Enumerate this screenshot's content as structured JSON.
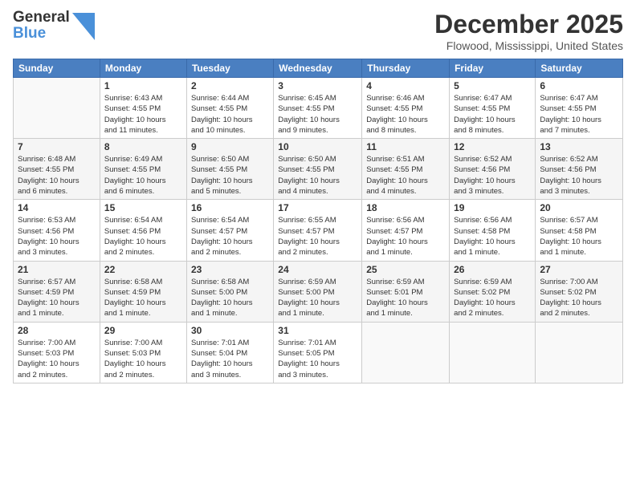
{
  "logo": {
    "line1": "General",
    "line2": "Blue"
  },
  "header": {
    "month": "December 2025",
    "location": "Flowood, Mississippi, United States"
  },
  "weekdays": [
    "Sunday",
    "Monday",
    "Tuesday",
    "Wednesday",
    "Thursday",
    "Friday",
    "Saturday"
  ],
  "weeks": [
    [
      {
        "day": "",
        "info": ""
      },
      {
        "day": "1",
        "info": "Sunrise: 6:43 AM\nSunset: 4:55 PM\nDaylight: 10 hours\nand 11 minutes."
      },
      {
        "day": "2",
        "info": "Sunrise: 6:44 AM\nSunset: 4:55 PM\nDaylight: 10 hours\nand 10 minutes."
      },
      {
        "day": "3",
        "info": "Sunrise: 6:45 AM\nSunset: 4:55 PM\nDaylight: 10 hours\nand 9 minutes."
      },
      {
        "day": "4",
        "info": "Sunrise: 6:46 AM\nSunset: 4:55 PM\nDaylight: 10 hours\nand 8 minutes."
      },
      {
        "day": "5",
        "info": "Sunrise: 6:47 AM\nSunset: 4:55 PM\nDaylight: 10 hours\nand 8 minutes."
      },
      {
        "day": "6",
        "info": "Sunrise: 6:47 AM\nSunset: 4:55 PM\nDaylight: 10 hours\nand 7 minutes."
      }
    ],
    [
      {
        "day": "7",
        "info": "Sunrise: 6:48 AM\nSunset: 4:55 PM\nDaylight: 10 hours\nand 6 minutes."
      },
      {
        "day": "8",
        "info": "Sunrise: 6:49 AM\nSunset: 4:55 PM\nDaylight: 10 hours\nand 6 minutes."
      },
      {
        "day": "9",
        "info": "Sunrise: 6:50 AM\nSunset: 4:55 PM\nDaylight: 10 hours\nand 5 minutes."
      },
      {
        "day": "10",
        "info": "Sunrise: 6:50 AM\nSunset: 4:55 PM\nDaylight: 10 hours\nand 4 minutes."
      },
      {
        "day": "11",
        "info": "Sunrise: 6:51 AM\nSunset: 4:55 PM\nDaylight: 10 hours\nand 4 minutes."
      },
      {
        "day": "12",
        "info": "Sunrise: 6:52 AM\nSunset: 4:56 PM\nDaylight: 10 hours\nand 3 minutes."
      },
      {
        "day": "13",
        "info": "Sunrise: 6:52 AM\nSunset: 4:56 PM\nDaylight: 10 hours\nand 3 minutes."
      }
    ],
    [
      {
        "day": "14",
        "info": "Sunrise: 6:53 AM\nSunset: 4:56 PM\nDaylight: 10 hours\nand 3 minutes."
      },
      {
        "day": "15",
        "info": "Sunrise: 6:54 AM\nSunset: 4:56 PM\nDaylight: 10 hours\nand 2 minutes."
      },
      {
        "day": "16",
        "info": "Sunrise: 6:54 AM\nSunset: 4:57 PM\nDaylight: 10 hours\nand 2 minutes."
      },
      {
        "day": "17",
        "info": "Sunrise: 6:55 AM\nSunset: 4:57 PM\nDaylight: 10 hours\nand 2 minutes."
      },
      {
        "day": "18",
        "info": "Sunrise: 6:56 AM\nSunset: 4:57 PM\nDaylight: 10 hours\nand 1 minute."
      },
      {
        "day": "19",
        "info": "Sunrise: 6:56 AM\nSunset: 4:58 PM\nDaylight: 10 hours\nand 1 minute."
      },
      {
        "day": "20",
        "info": "Sunrise: 6:57 AM\nSunset: 4:58 PM\nDaylight: 10 hours\nand 1 minute."
      }
    ],
    [
      {
        "day": "21",
        "info": "Sunrise: 6:57 AM\nSunset: 4:59 PM\nDaylight: 10 hours\nand 1 minute."
      },
      {
        "day": "22",
        "info": "Sunrise: 6:58 AM\nSunset: 4:59 PM\nDaylight: 10 hours\nand 1 minute."
      },
      {
        "day": "23",
        "info": "Sunrise: 6:58 AM\nSunset: 5:00 PM\nDaylight: 10 hours\nand 1 minute."
      },
      {
        "day": "24",
        "info": "Sunrise: 6:59 AM\nSunset: 5:00 PM\nDaylight: 10 hours\nand 1 minute."
      },
      {
        "day": "25",
        "info": "Sunrise: 6:59 AM\nSunset: 5:01 PM\nDaylight: 10 hours\nand 1 minute."
      },
      {
        "day": "26",
        "info": "Sunrise: 6:59 AM\nSunset: 5:02 PM\nDaylight: 10 hours\nand 2 minutes."
      },
      {
        "day": "27",
        "info": "Sunrise: 7:00 AM\nSunset: 5:02 PM\nDaylight: 10 hours\nand 2 minutes."
      }
    ],
    [
      {
        "day": "28",
        "info": "Sunrise: 7:00 AM\nSunset: 5:03 PM\nDaylight: 10 hours\nand 2 minutes."
      },
      {
        "day": "29",
        "info": "Sunrise: 7:00 AM\nSunset: 5:03 PM\nDaylight: 10 hours\nand 2 minutes."
      },
      {
        "day": "30",
        "info": "Sunrise: 7:01 AM\nSunset: 5:04 PM\nDaylight: 10 hours\nand 3 minutes."
      },
      {
        "day": "31",
        "info": "Sunrise: 7:01 AM\nSunset: 5:05 PM\nDaylight: 10 hours\nand 3 minutes."
      },
      {
        "day": "",
        "info": ""
      },
      {
        "day": "",
        "info": ""
      },
      {
        "day": "",
        "info": ""
      }
    ]
  ]
}
